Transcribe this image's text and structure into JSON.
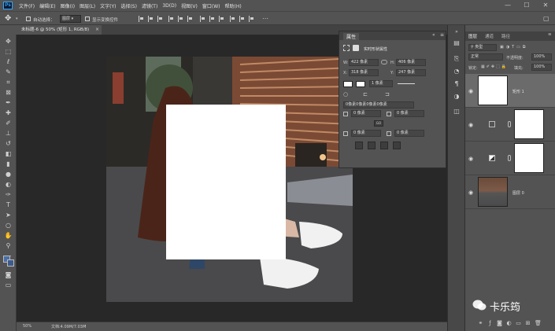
{
  "app": {
    "logo_text": "Ps"
  },
  "menu": [
    "文件(F)",
    "编辑(E)",
    "图像(I)",
    "图层(L)",
    "文字(Y)",
    "选择(S)",
    "滤镜(T)",
    "3D(D)",
    "视图(V)",
    "窗口(W)",
    "帮助(H)"
  ],
  "window_controls": {
    "minimize": "—",
    "maximize": "☐",
    "close": "✕"
  },
  "options": {
    "auto_select_label": "自动选择：",
    "auto_select_value": "图层",
    "transform_label": "显示变换控件"
  },
  "document": {
    "tab_title": "未标题-6 @ 50% (矩形 1, RGB/8)",
    "tab_close": "×",
    "zoom": "50%",
    "status": "文档:4.09M/7.03M"
  },
  "properties": {
    "title": "属性",
    "subtitle": "实时形状属性",
    "w_label": "W:",
    "w_value": "422 像素",
    "h_label": "H:",
    "h_value": "406 像素",
    "x_label": "X:",
    "x_value": "318 像素",
    "y_label": "Y:",
    "y_value": "247 像素",
    "stroke_width": "1 像素",
    "corner_all": "0像素0像素0像素0像素",
    "corner_tl": "0 像素",
    "corner_tr": "0 像素",
    "corner_bl": "0 像素",
    "corner_br": "0 像素",
    "corner_mid": "GO"
  },
  "panel_tabs": {
    "layers": "图层",
    "channels": "通道",
    "paths": "路径"
  },
  "layers_panel": {
    "kind_filter": "类型",
    "blend_mode": "正常",
    "opacity_label": "不透明度:",
    "opacity_value": "100%",
    "lock_label": "锁定:",
    "fill_label": "填充:",
    "fill_value": "100%",
    "layers": [
      {
        "name": "矩形 1",
        "selected": true
      },
      {
        "name": "",
        "selected": false
      },
      {
        "name": "",
        "selected": false
      },
      {
        "name": "图层 0",
        "selected": false
      }
    ]
  },
  "watermark": {
    "text": "卡乐筠"
  },
  "colors": {
    "ui_bg": "#535353",
    "canvas_bg": "#282828",
    "accent": "#31a8ff",
    "selected_layer": "#6b6b6b"
  }
}
